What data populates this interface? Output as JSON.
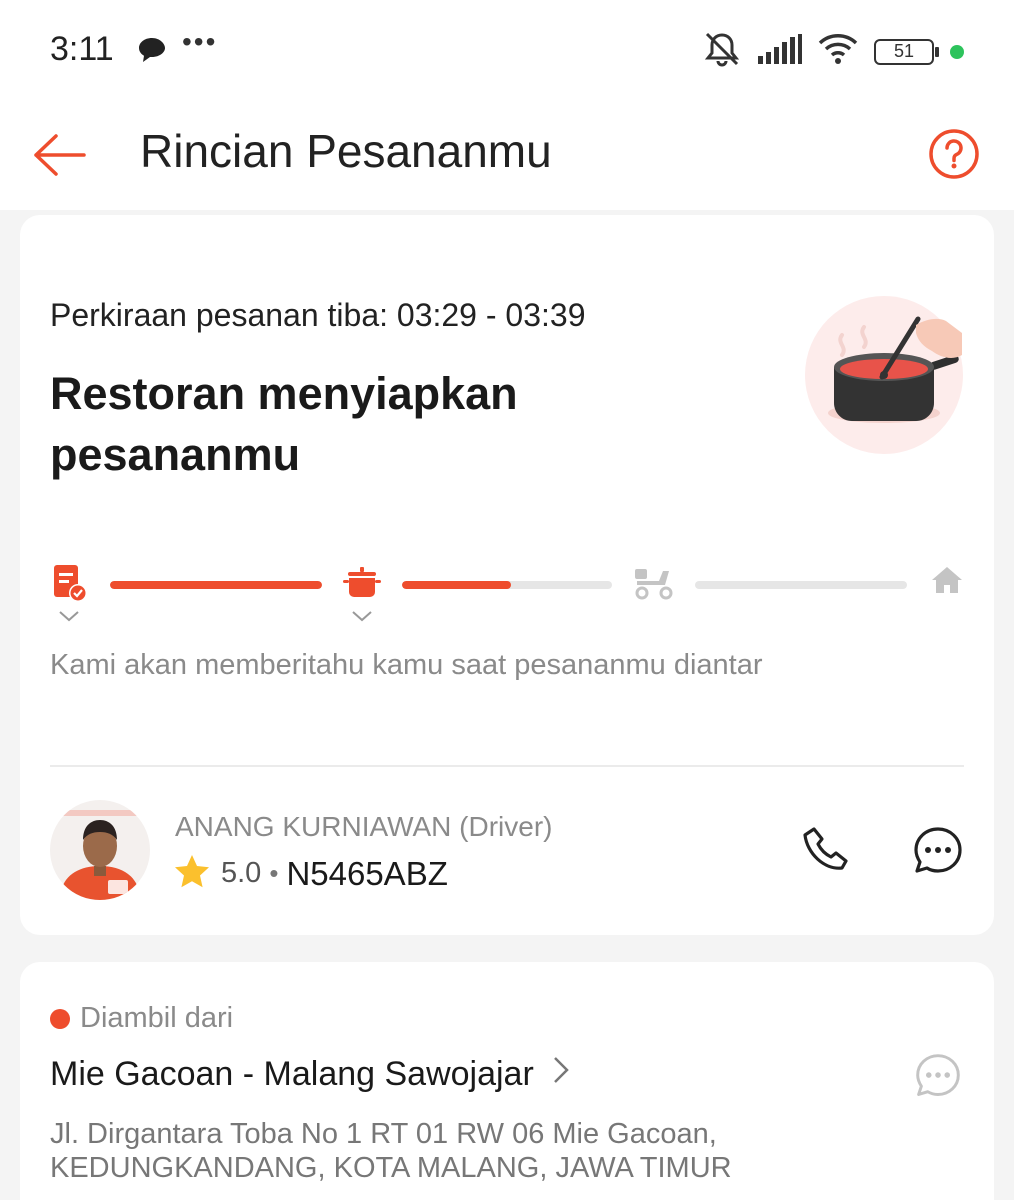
{
  "status_bar": {
    "time": "3:11",
    "dots": "•••",
    "battery": "51",
    "icons": [
      "message-bubble-icon",
      "bell-muted-icon",
      "signal-icon",
      "wifi-icon",
      "battery-icon"
    ]
  },
  "header": {
    "title": "Rincian Pesananmu",
    "back_icon": "arrow-left-icon",
    "help_icon": "help-icon"
  },
  "order_status": {
    "eta": "Perkiraan pesanan tiba: 03:29 - 03:39",
    "headline": "Restoran menyiapkan pesananmu",
    "notice": "Kami akan memberitahu kamu saat pesananmu diantar",
    "steps": [
      {
        "icon": "order-confirmed-icon",
        "state": "done"
      },
      {
        "icon": "cooking-pot-icon",
        "state": "active"
      },
      {
        "icon": "scooter-icon",
        "state": "pending"
      },
      {
        "icon": "home-icon",
        "state": "pending"
      }
    ],
    "segment_progress": [
      1.0,
      0.52,
      0.0
    ]
  },
  "driver": {
    "name": "ANANG KURNIAWAN (Driver)",
    "rating": "5.0",
    "separator": "•",
    "plate": "N5465ABZ"
  },
  "pickup": {
    "label": "Diambil dari",
    "restaurant": "Mie Gacoan - Malang Sawojajar",
    "address": "Jl. Dirgantara Toba No 1 RT 01 RW 06  Mie Gacoan, KEDUNGKANDANG, KOTA MALANG, JAWA TIMUR"
  },
  "colors": {
    "accent": "#ee4d2d",
    "muted": "#8a8a8a",
    "track": "#e6e6e6",
    "online": "#2dc35c"
  }
}
